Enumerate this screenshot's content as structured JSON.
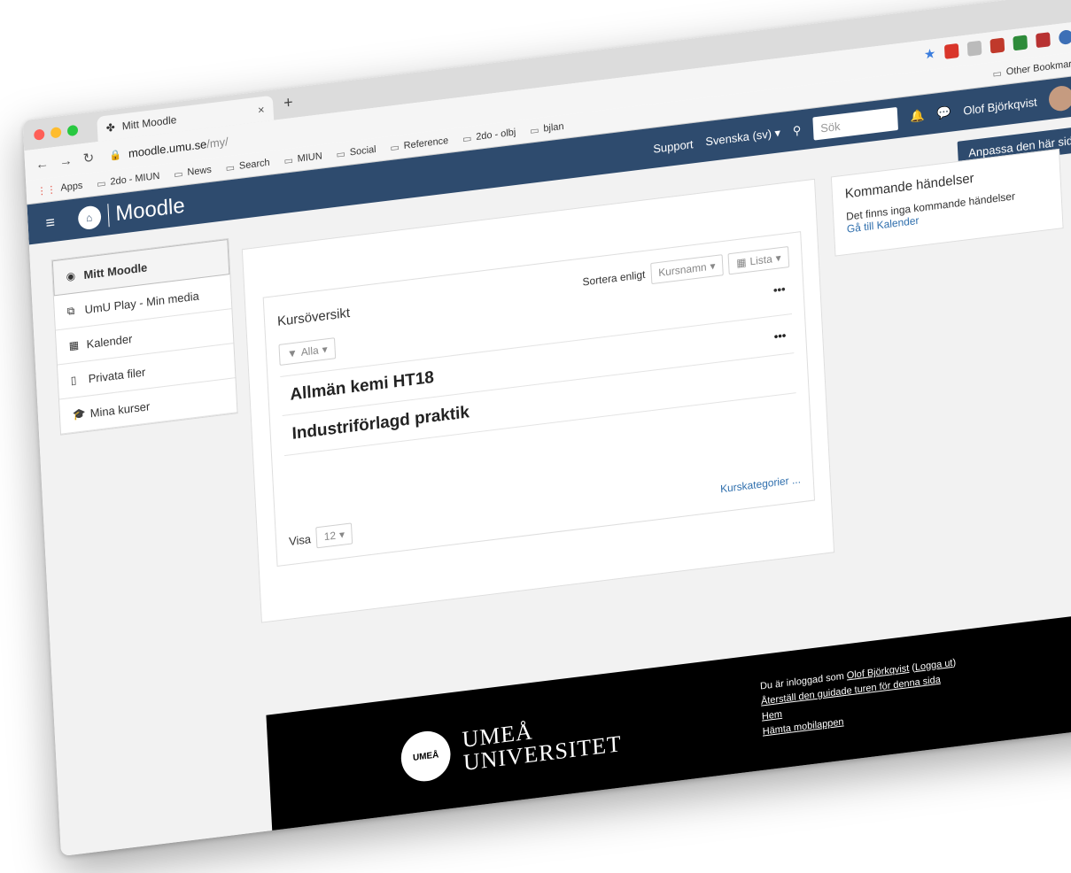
{
  "browser": {
    "tab_title": "Mitt Moodle",
    "tab_close": "×",
    "new_tab": "+",
    "url_host": "moodle.umu.se",
    "url_path": "/my/",
    "bookmarks": [
      "Apps",
      "2do - MIUN",
      "News",
      "Search",
      "MIUN",
      "Social",
      "Reference",
      "2do - olbj",
      "bjlan"
    ],
    "other_bookmarks": "Other Bookmarks"
  },
  "navbar": {
    "brand": "Moodle",
    "support": "Support",
    "language": "Svenska (sv)",
    "search_placeholder": "Sök",
    "user_name": "Olof Björkqvist"
  },
  "page": {
    "customize_button": "Anpassa den här sidan"
  },
  "left_nav": {
    "items": [
      {
        "label": "Mitt Moodle",
        "icon": "dashboard-icon"
      },
      {
        "label": "UmU Play - Min media",
        "icon": "media-icon"
      },
      {
        "label": "Kalender",
        "icon": "calendar-icon"
      },
      {
        "label": "Privata filer",
        "icon": "file-icon"
      },
      {
        "label": "Mina kurser",
        "icon": "graduation-cap-icon"
      }
    ]
  },
  "overview": {
    "title": "Kursöversikt",
    "sort_label": "Sortera enligt",
    "sort_value": "Kursnamn",
    "view_value": "Lista",
    "filter_value": "Alla",
    "more": "•••",
    "courses": [
      "Allmän kemi HT18",
      "Industriförlagd praktik"
    ],
    "show_label": "Visa",
    "show_value": "12",
    "categories_link": "Kurskategorier ..."
  },
  "events": {
    "title": "Kommande händelser",
    "empty_text": "Det finns inga kommande händelser",
    "calendar_link": "Gå till Kalender"
  },
  "footer": {
    "logo_line1": "UMEÅ",
    "logo_line2": "UNIVERSITET",
    "logged_in_prefix": "Du är inloggad som ",
    "logged_in_user": "Olof Björkqvist",
    "logout": "Logga ut",
    "reset_tour": "Återställ den guidade turen för denna sida",
    "home": "Hem",
    "mobile_app": "Hämta mobilappen"
  }
}
